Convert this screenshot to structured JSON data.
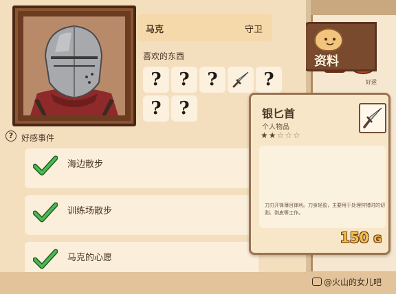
{
  "character": {
    "name": "马克",
    "role": "守卫"
  },
  "likes": {
    "title": "喜欢的东西",
    "slots": [
      {
        "symbol": "?"
      },
      {
        "symbol": "?"
      },
      {
        "symbol": "?"
      },
      {
        "icon": "silver-dagger-icon"
      },
      {
        "symbol": "?"
      },
      {
        "symbol": "?"
      },
      {
        "symbol": "?"
      }
    ]
  },
  "events": {
    "header_icon": "?",
    "title": "好感事件",
    "items": [
      {
        "label": "海边散步",
        "done": true
      },
      {
        "label": "训练场散步",
        "done": true
      },
      {
        "label": "马克的心愿",
        "done": true
      }
    ]
  },
  "tooltip": {
    "name": "银匕首",
    "category": "个人物品",
    "rating": 2,
    "rating_max": 5,
    "description": "刀刃开锋薄且锋利。刀身轻盈，主要用于处理狩猎时的切割、剥皮等工作。",
    "price": "150",
    "price_unit": "G"
  },
  "right_tab": {
    "label": "资料",
    "note": "好运"
  },
  "watermark": "@火山的女儿吧",
  "colors": {
    "panel": "#f3dfbe",
    "card": "#fbeedb",
    "accent_gold": "#f2c04c",
    "check_green": "#2f8a3c",
    "frame_brown": "#6b3b22"
  }
}
